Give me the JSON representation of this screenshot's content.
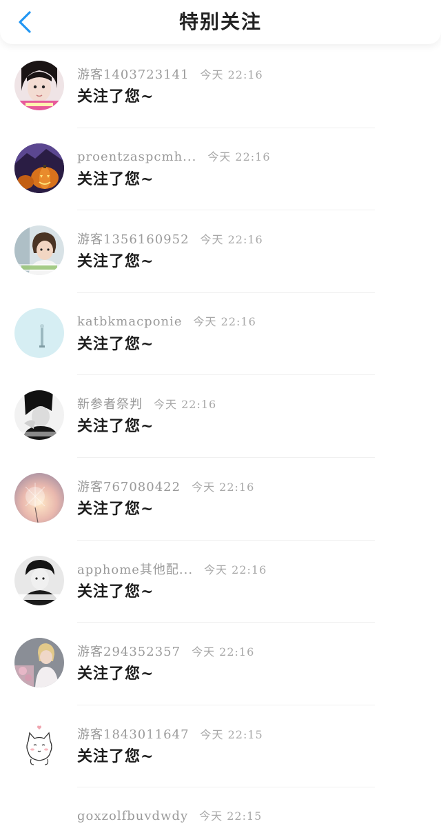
{
  "header": {
    "title": "特别关注",
    "back_icon": "chevron-left-icon",
    "accent_color": "#2196f3"
  },
  "items": [
    {
      "name": "游客1403723141",
      "time": "今天 22:16",
      "message": "关注了您~",
      "avatar": "girl-portrait"
    },
    {
      "name": "proentzaspcmh...",
      "time": "今天 22:16",
      "message": "关注了您~",
      "avatar": "halloween-pumpkin"
    },
    {
      "name": "游客1356160952",
      "time": "今天 22:16",
      "message": "关注了您~",
      "avatar": "short-hair-girl"
    },
    {
      "name": "katbkmacponie",
      "time": "今天 22:16",
      "message": "关注了您~",
      "avatar": "light-blue-minimal"
    },
    {
      "name": "新参者祭判",
      "time": "今天 22:16",
      "message": "关注了您~",
      "avatar": "bw-boy"
    },
    {
      "name": "游客767080422",
      "time": "今天 22:16",
      "message": "关注了您~",
      "avatar": "dandelion-sunset"
    },
    {
      "name": "apphome其他配...",
      "time": "今天 22:16",
      "message": "关注了您~",
      "avatar": "bw-boy-text"
    },
    {
      "name": "游客294352357",
      "time": "今天 22:16",
      "message": "关注了您~",
      "avatar": "girl-flowers"
    },
    {
      "name": "游客1843011647",
      "time": "今天 22:15",
      "message": "关注了您~",
      "avatar": "cartoon-cat"
    },
    {
      "name": "goxzolfbuvdwdy",
      "time": "今天 22:15",
      "message": "",
      "avatar": "none"
    }
  ]
}
